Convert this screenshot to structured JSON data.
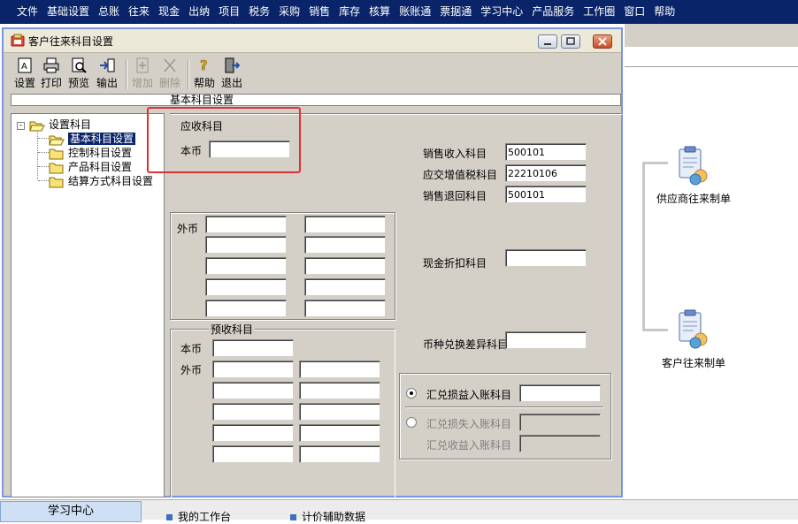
{
  "menubar": [
    "文件",
    "基础设置",
    "总账",
    "往来",
    "现金",
    "出纳",
    "项目",
    "税务",
    "采购",
    "销售",
    "库存",
    "核算",
    "账账通",
    "票据通",
    "学习中心",
    "产品服务",
    "工作圈",
    "窗口",
    "帮助"
  ],
  "dialog": {
    "title": "客户往来科目设置",
    "toolbar": {
      "setup": "设置",
      "print": "打印",
      "preview": "预览",
      "export": "输出",
      "add": "增加",
      "delete": "删除",
      "help": "帮助",
      "exit": "退出"
    },
    "breadcrumb": "基本科目设置",
    "tree": {
      "root": "设置科目",
      "items": [
        "基本科目设置",
        "控制科目设置",
        "产品科目设置",
        "结算方式科目设置"
      ]
    },
    "form": {
      "receivable_group": "应收科目",
      "local_currency": "本币",
      "foreign_currency": "外币",
      "sales_revenue_label": "销售收入科目",
      "sales_revenue_value": "500101",
      "output_vat_label": "应交增值税科目",
      "output_vat_value": "22210106",
      "sales_return_label": "销售退回科目",
      "sales_return_value": "500101",
      "cash_discount_label": "现金折扣科目",
      "prepaid_group": "预收科目",
      "prepaid_local": "本币",
      "prepaid_foreign": "外币",
      "fx_diff_label": "币种兑换差异科目",
      "fx_gain_loss_label": "汇兑损益入账科目",
      "fx_loss_label": "汇兑损失入账科目",
      "fx_gain_label": "汇兑收益入账科目"
    }
  },
  "background": {
    "supplier_voucher": "供应商往来制单",
    "customer_voucher": "客户往来制单"
  },
  "bottom": {
    "learning_center": "学习中心",
    "my_workbench": "我的工作台",
    "pricing_data": "计价辅助数据"
  }
}
